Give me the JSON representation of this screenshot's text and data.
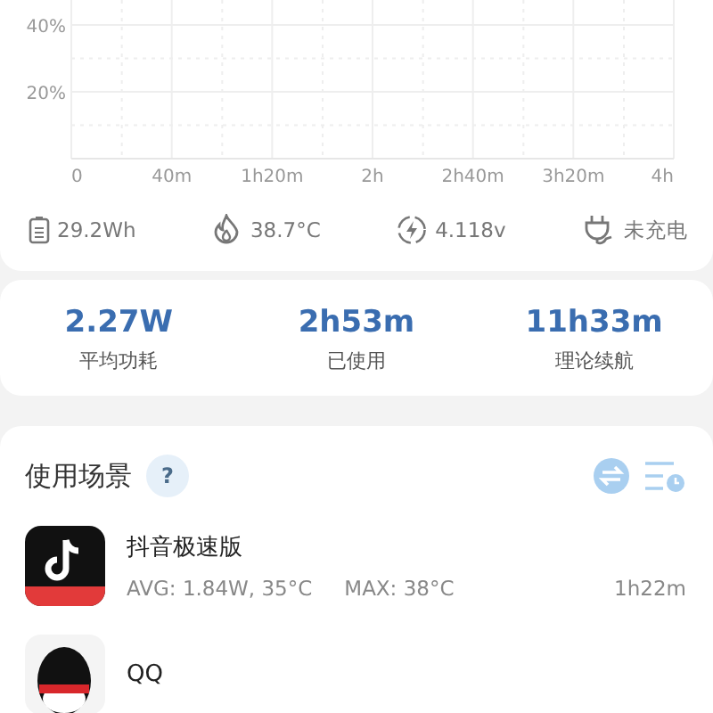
{
  "chart": {
    "chart_data": {
      "type": "line",
      "categories": [
        "0",
        "40m",
        "1h20m",
        "2h",
        "2h40m",
        "3h20m",
        "4h"
      ],
      "yticks": [
        {
          "value": 20,
          "label": "20%"
        },
        {
          "value": 40,
          "label": "40%"
        }
      ],
      "ylim": [
        0,
        40
      ],
      "grid": true
    }
  },
  "stats": [
    {
      "kind": "battery",
      "text": "29.2Wh"
    },
    {
      "kind": "temperature",
      "text": "38.7°C"
    },
    {
      "kind": "voltage",
      "text": "4.118v"
    },
    {
      "kind": "plug",
      "text": "未充电"
    }
  ],
  "summary": [
    {
      "value": "2.27W",
      "label": "平均功耗"
    },
    {
      "value": "2h53m",
      "label": "已使用"
    },
    {
      "value": "11h33m",
      "label": "理论续航"
    }
  ],
  "scenes": {
    "title": "使用场景",
    "help": "?",
    "apps": [
      {
        "kind": "video",
        "name": "抖音极速版",
        "avg": "AVG: 1.84W, 35°C",
        "max": "MAX:  38°C",
        "duration": "1h22m"
      },
      {
        "kind": "chat",
        "name": "QQ"
      }
    ]
  }
}
